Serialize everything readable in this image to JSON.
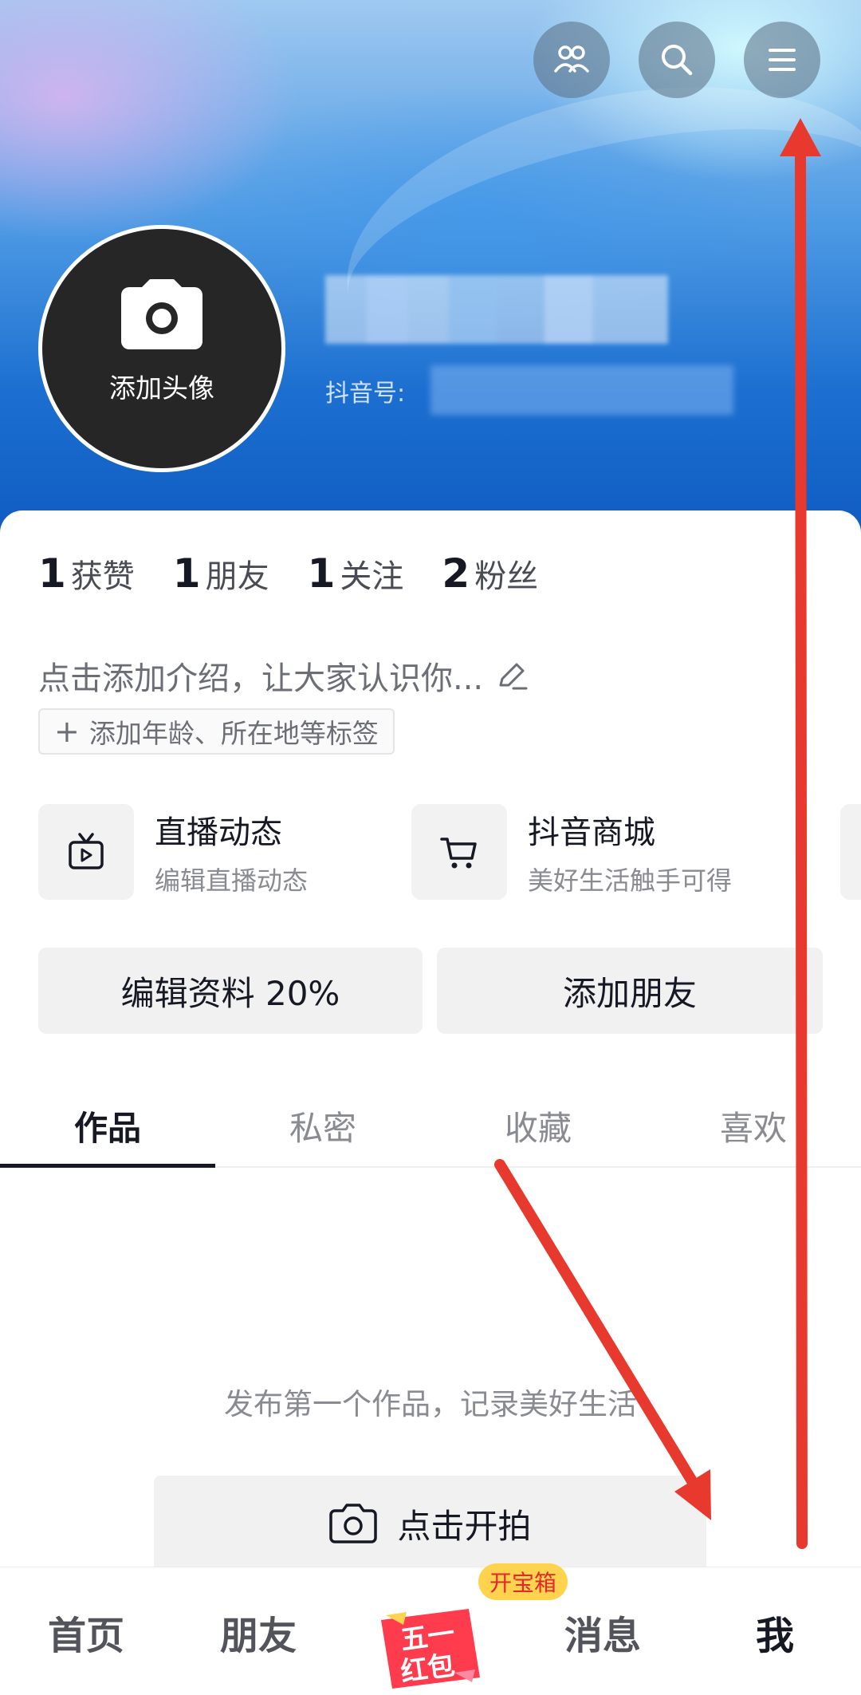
{
  "header": {
    "avatar_label": "添加头像",
    "douyin_id_label": "抖音号:"
  },
  "stats": [
    {
      "num": "1",
      "label": "获赞"
    },
    {
      "num": "1",
      "label": "朋友"
    },
    {
      "num": "1",
      "label": "关注"
    },
    {
      "num": "2",
      "label": "粉丝"
    }
  ],
  "profile": {
    "intro_placeholder": "点击添加介绍，让大家认识你...",
    "tag_chip_label": "添加年龄、所在地等标签"
  },
  "features": [
    {
      "title": "直播动态",
      "subtitle": "编辑直播动态",
      "icon": "tv-icon"
    },
    {
      "title": "抖音商城",
      "subtitle": "美好生活触手可得",
      "icon": "cart-icon"
    }
  ],
  "actions": {
    "edit_profile": "编辑资料 20%",
    "add_friend": "添加朋友"
  },
  "tabs": [
    "作品",
    "私密",
    "收藏",
    "喜欢"
  ],
  "empty_state": {
    "message": "发布第一个作品，记录美好生活",
    "shoot_button": "点击开拍"
  },
  "bottom_nav": {
    "home": "首页",
    "friends": "朋友",
    "center_badge": "开宝箱",
    "center_label_line1": "五一",
    "center_label_line2": "红包",
    "messages": "消息",
    "me": "我"
  },
  "colors": {
    "banner_deep_blue": "#0e59c0",
    "annotation_red": "#e8392e",
    "badge_yellow": "#ffd34e",
    "text_primary": "#161823"
  }
}
